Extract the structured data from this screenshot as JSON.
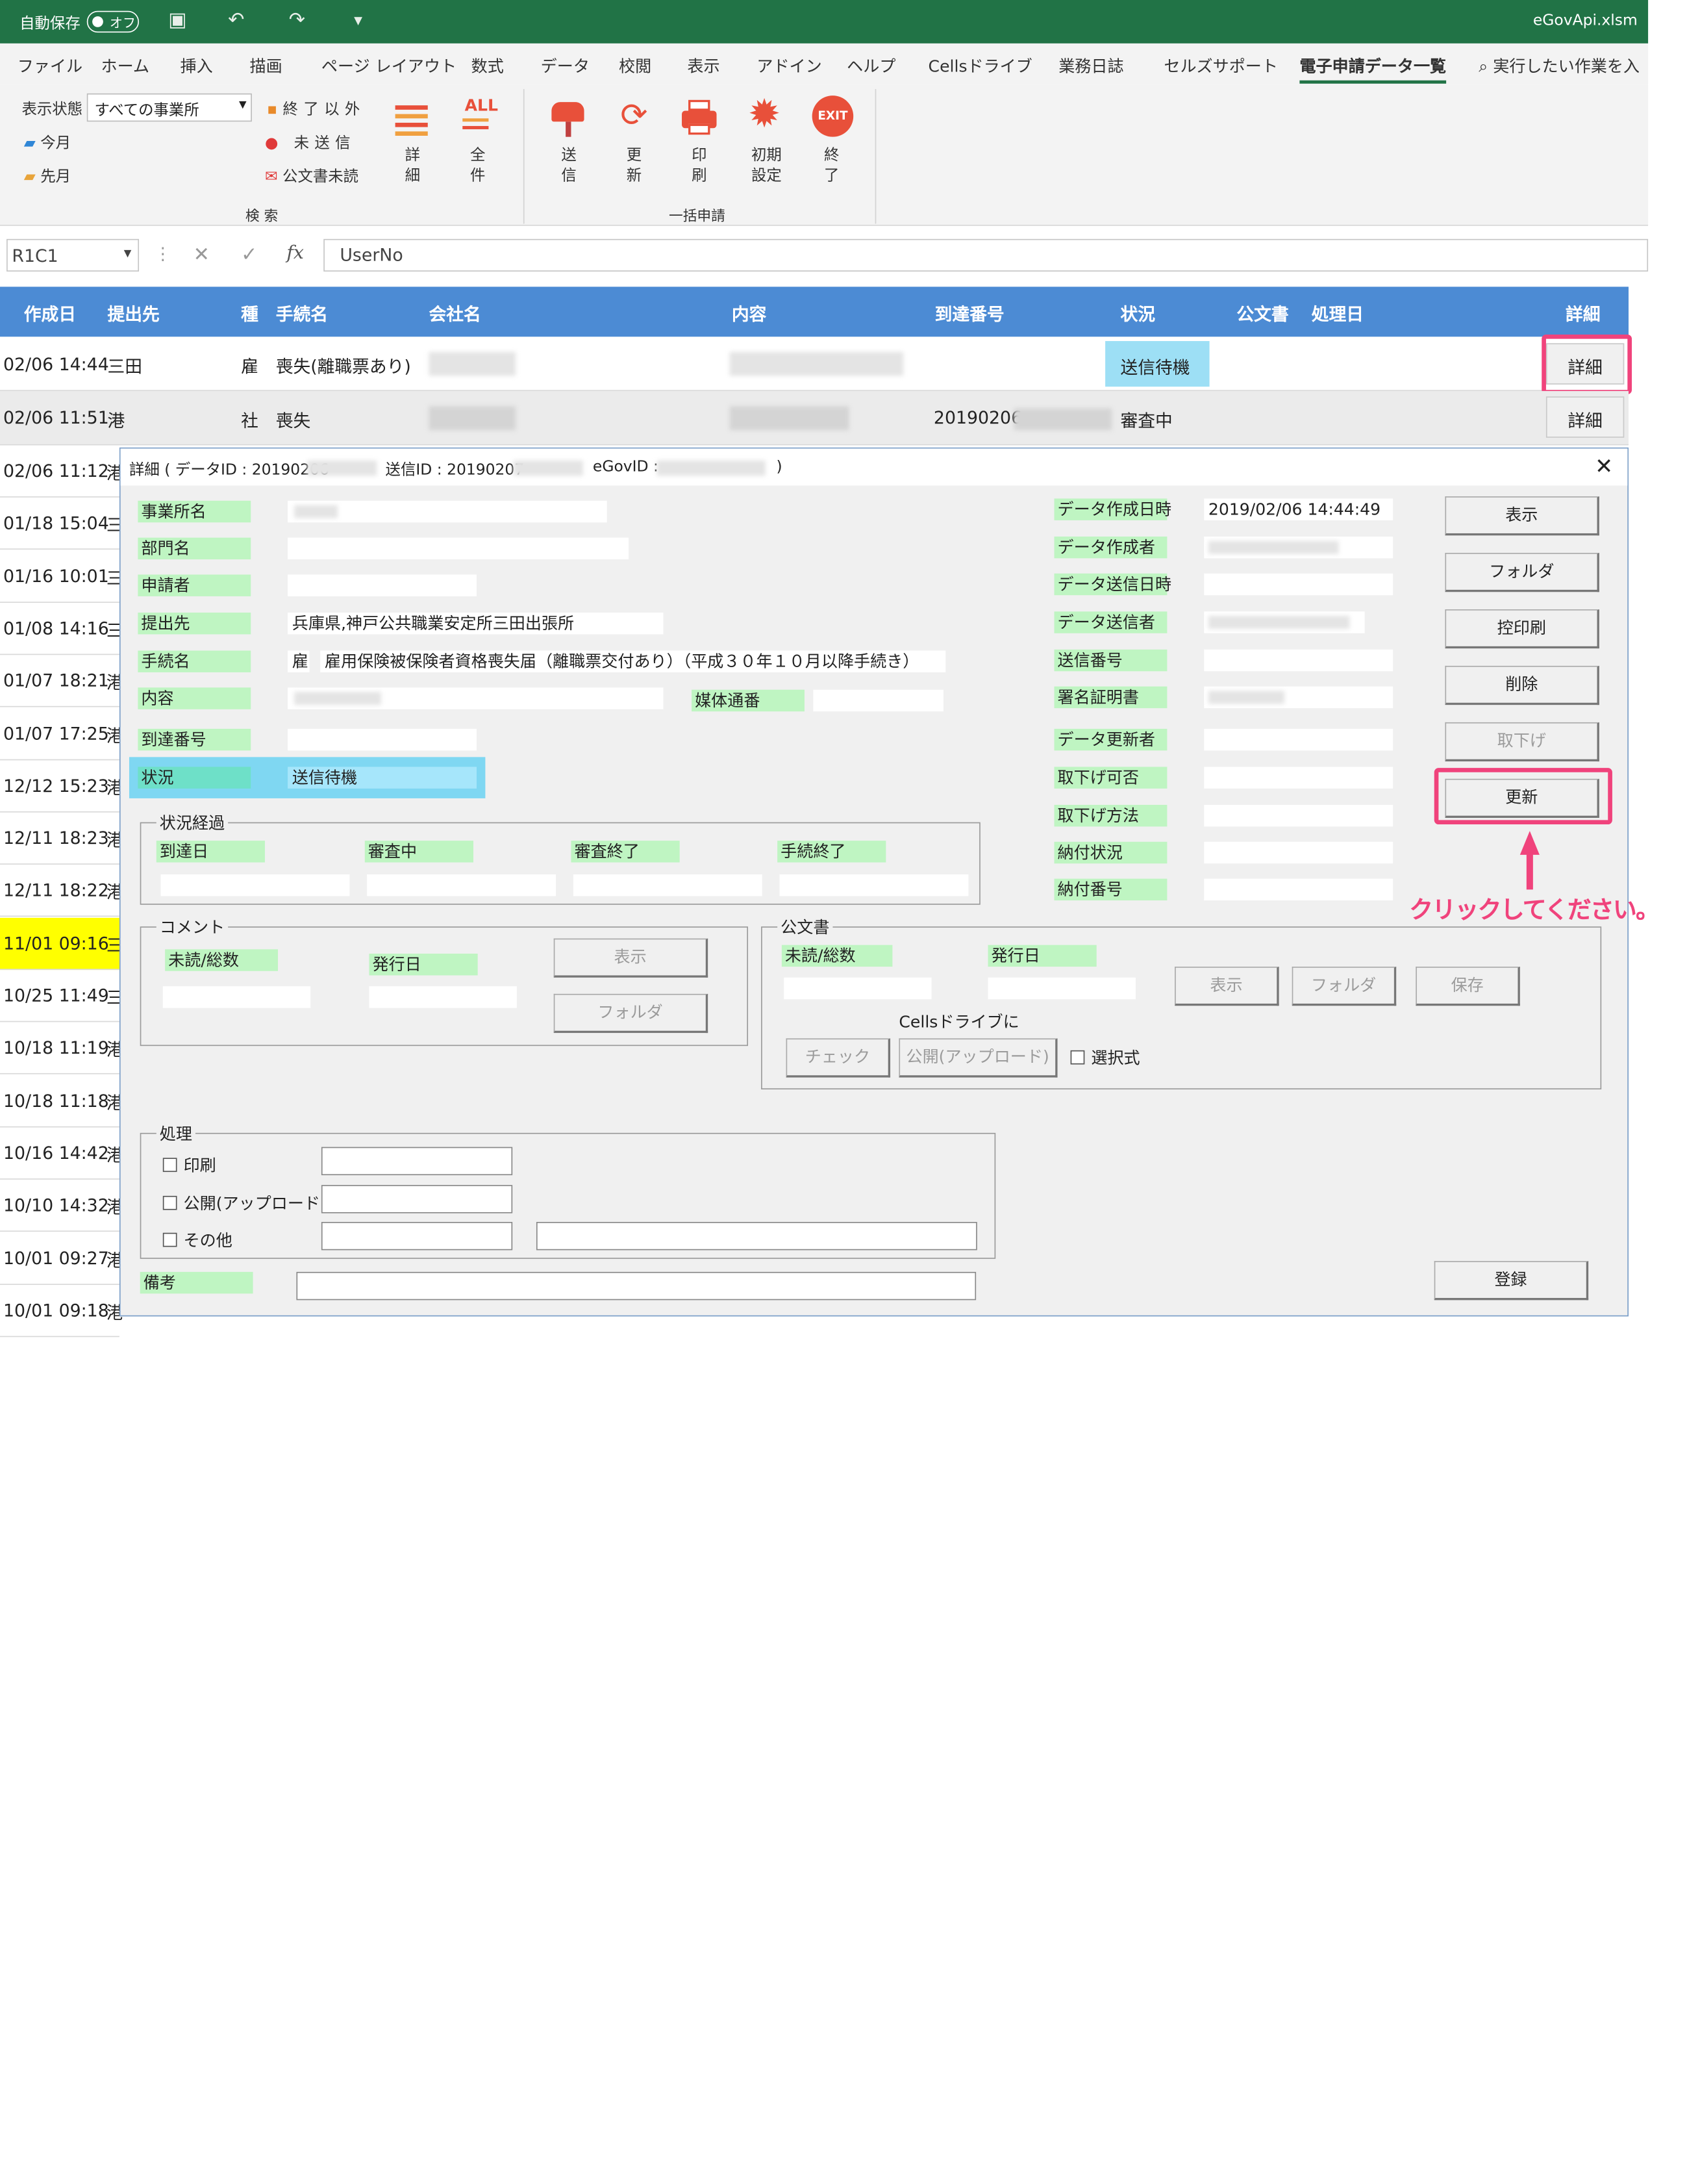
{
  "window": {
    "autosave_label": "自動保存",
    "autosave_state": "オフ",
    "filename": "eGovApi.xlsm"
  },
  "menu": [
    "ファイル",
    "ホーム",
    "挿入",
    "描画",
    "ページ レイアウト",
    "数式",
    "データ",
    "校閲",
    "表示",
    "アドイン",
    "ヘルプ",
    "Cellsドライブ",
    "業務日誌",
    "セルズサポート",
    "電子申請データ一覧",
    "実行したい作業を入"
  ],
  "ribbon": {
    "filter_label": "表示状態",
    "filter_value": "すべての事業所",
    "this_month": "今月",
    "last_month": "先月",
    "not_finished": "終了以外",
    "not_sent": "未送信",
    "doc_unread": "公文書未読",
    "detail": "詳細",
    "all": "全件",
    "search_group": "検 索",
    "send": "送信",
    "update": "更新",
    "print": "印刷",
    "init": "初期設定",
    "exit": "終了",
    "exit_icon_text": "EXIT",
    "all_icon_text": "ALL",
    "batch_group": "一括申請"
  },
  "formula_bar": {
    "name_box": "R1C1",
    "fx": "fx",
    "value": "UserNo"
  },
  "table": {
    "headers": {
      "created": "作成日",
      "dest": "提出先",
      "kind": "種",
      "proc": "手続名",
      "company": "会社名",
      "content": "内容",
      "arrival": "到達番号",
      "status": "状況",
      "doc": "公文書",
      "date": "処理日",
      "detail": "詳細"
    },
    "row1": {
      "date": "02/06 14:44",
      "dest": "三田",
      "kind": "雇",
      "proc": "喪失(離職票あり)",
      "status": "送信待機",
      "detail": "詳細"
    },
    "row2": {
      "date": "02/06 11:51",
      "dest": "港",
      "kind": "社",
      "proc": "喪失",
      "arrival": "20190206",
      "status": "審査中",
      "detail": "詳細"
    },
    "dates": [
      "02/06 11:12",
      "01/18 15:04",
      "01/16 10:01",
      "01/08 14:16",
      "01/07 18:21",
      "01/07 17:25",
      "12/12 15:23",
      "12/11 18:23",
      "12/11 18:22",
      "11/01 09:16",
      "10/25 11:49",
      "10/18 11:19",
      "10/18 11:18",
      "10/16 14:42",
      "10/10 14:32",
      "10/01 09:27",
      "10/01 09:18"
    ],
    "dests": [
      "港",
      "三",
      "三",
      "三",
      "港",
      "港",
      "港",
      "港",
      "港",
      "三",
      "三",
      "港",
      "港",
      "港",
      "港",
      "港",
      "港"
    ],
    "highlight_color": "#ffff00"
  },
  "dialog": {
    "title_prefix": "詳細 ( データID : 20190206",
    "title_send": "送信ID : 20190207",
    "title_egov": "eGovID :",
    "title_close": ")",
    "labels": {
      "office": "事業所名",
      "dept": "部門名",
      "applicant": "申請者",
      "dest": "提出先",
      "proc": "手続名",
      "content": "内容",
      "media": "媒体通番",
      "arrival": "到達番号",
      "status": "状況",
      "created_at": "データ作成日時",
      "creator": "データ作成者",
      "sent_at": "データ送信日時",
      "sender": "データ送信者",
      "send_no": "送信番号",
      "cert": "署名証明書",
      "updater": "データ更新者",
      "withdraw_ok": "取下げ可否",
      "withdraw_method": "取下げ方法",
      "payment_status": "納付状況",
      "payment_no": "納付番号"
    },
    "values": {
      "dest": "兵庫県,神戸公共職業安定所三田出張所",
      "proc_kind": "雇",
      "proc": "雇用保険被保険者資格喪失届（離職票交付あり）（平成３０年１０月以降手続き）",
      "status": "送信待機",
      "created_at": "2019/02/06 14:44:49"
    },
    "buttons": {
      "show": "表示",
      "folder": "フォルダ",
      "copy_print": "控印刷",
      "delete": "削除",
      "withdraw": "取下げ",
      "update": "更新",
      "register": "登録"
    },
    "progress": {
      "title": "状況経過",
      "arrival": "到達日",
      "review": "審査中",
      "review_end": "審査終了",
      "proc_end": "手続終了"
    },
    "comment": {
      "title": "コメント",
      "unread": "未読/総数",
      "issued": "発行日",
      "show": "表示",
      "folder": "フォルダ"
    },
    "doc": {
      "title": "公文書",
      "unread": "未読/総数",
      "issued": "発行日",
      "show": "表示",
      "folder": "フォルダ",
      "save": "保存",
      "cells": "Cellsドライブに",
      "check": "チェック",
      "publish": "公開(アップロード)",
      "selective": "選択式"
    },
    "process": {
      "title": "処理",
      "print": "印刷",
      "publish": "公開(アップロード)",
      "other": "その他"
    },
    "remarks": "備考"
  },
  "annotation": {
    "text": "クリックしてください。",
    "color": "#f0437c"
  }
}
